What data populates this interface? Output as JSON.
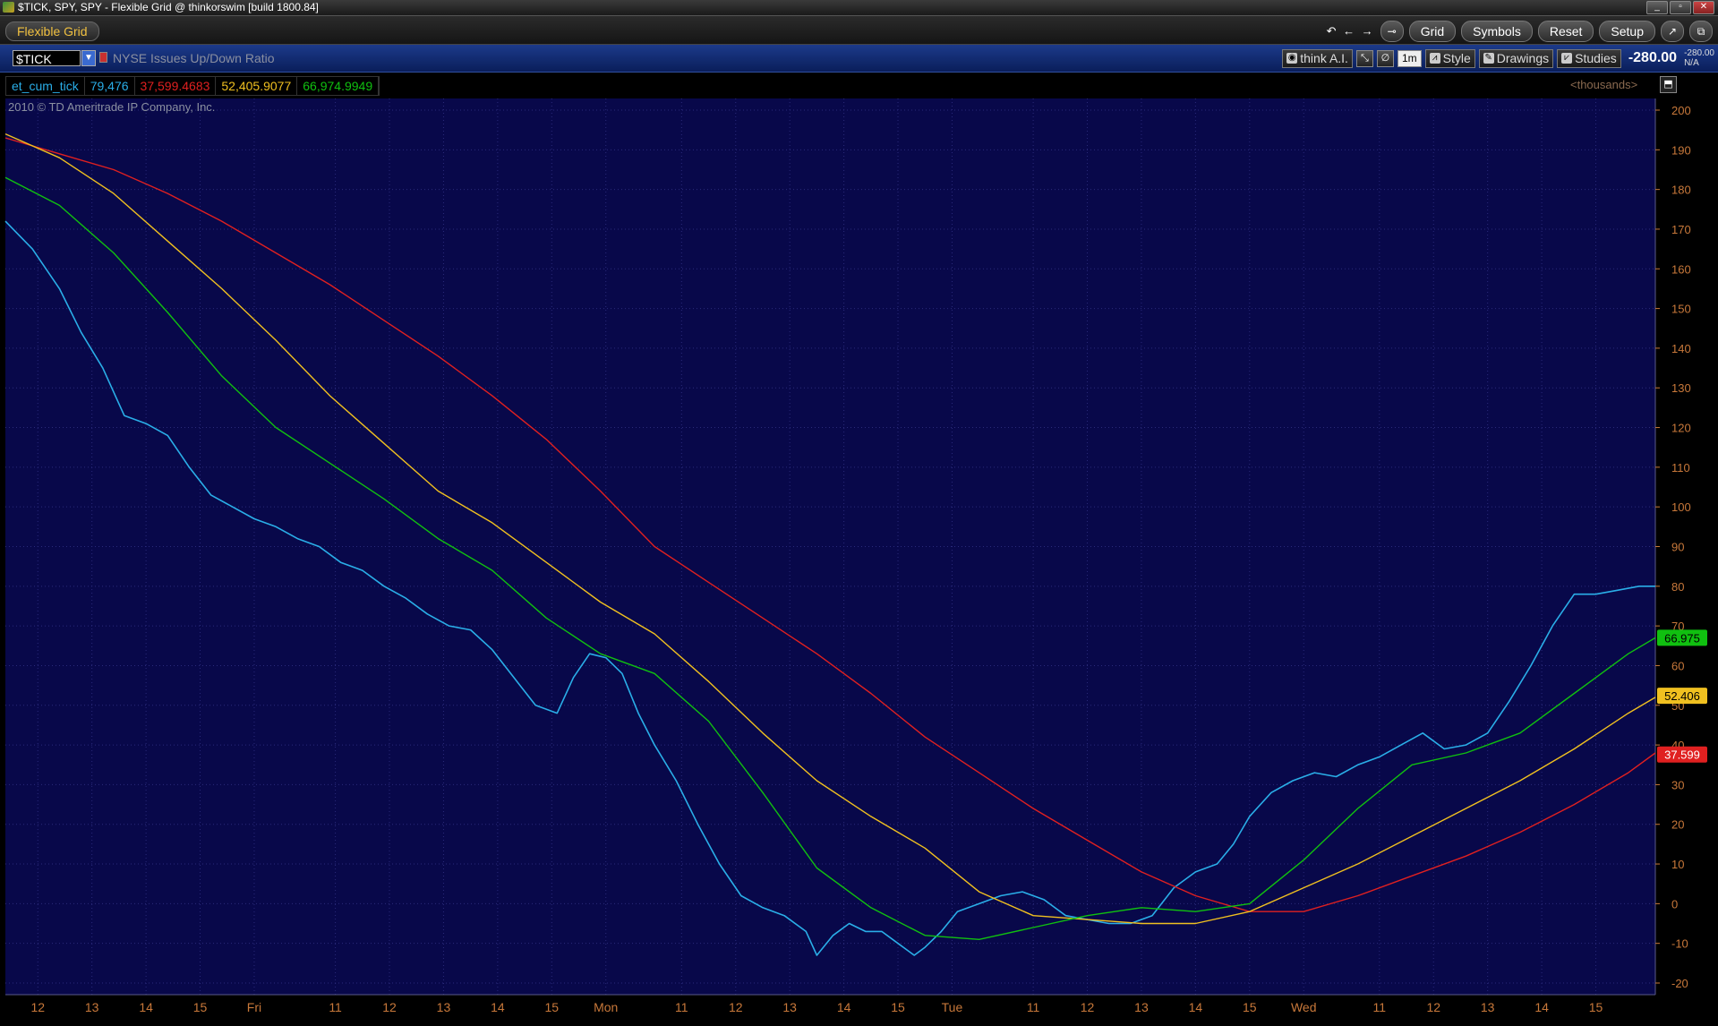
{
  "window": {
    "title": "$TICK, SPY, SPY - Flexible Grid @ thinkorswim [build 1800.84]",
    "controls": [
      "_",
      "▫",
      "✕"
    ]
  },
  "toolbar": {
    "grid_name": "Flexible Grid",
    "nav_arrows": "↶ ← →",
    "buttons": [
      "Grid",
      "Symbols",
      "Reset",
      "Setup"
    ]
  },
  "chart_header": {
    "symbol": "$TICK",
    "description": "NYSE Issues Up/Down Ratio",
    "think_ai": "think A.I.",
    "timeframe": "1m",
    "style": "Style",
    "drawings": "Drawings",
    "studies": "Studies",
    "last_price": "-280.00",
    "price_change": "-280.00",
    "price_pct": "N/A"
  },
  "study_values": {
    "name": "et_cum_tick",
    "v1": "79,476",
    "v2": "37,599.4683",
    "v3": "52,405.9077",
    "v4": "66,974.9949"
  },
  "units_label": "<thousands>",
  "copyright": "2010 © TD Ameritrade IP Company, Inc.",
  "colors": {
    "background": "#08084a",
    "grid": "#2a2a7a",
    "tick_series": "#2aaee8",
    "red_series": "#e02020",
    "yellow_series": "#f0c020",
    "green_series": "#10c010",
    "axis_text": "#c8783a"
  },
  "chart_data": {
    "type": "line",
    "units": "thousands",
    "ylim": [
      -20,
      200
    ],
    "y_ticks": [
      -20,
      -10,
      0,
      10,
      20,
      30,
      40,
      50,
      60,
      70,
      80,
      90,
      100,
      110,
      120,
      130,
      140,
      150,
      160,
      170,
      180,
      190,
      200
    ],
    "x_tick_labels": [
      "12",
      "13",
      "14",
      "15",
      "Fri",
      "11",
      "12",
      "13",
      "14",
      "15",
      "Mon",
      "11",
      "12",
      "13",
      "14",
      "15",
      "Tue",
      "11",
      "12",
      "13",
      "14",
      "15",
      "Wed",
      "11",
      "12",
      "13",
      "14",
      "15"
    ],
    "x_tick_positions": [
      0.6,
      1.6,
      2.6,
      3.6,
      4.6,
      6.1,
      7.1,
      8.1,
      9.1,
      10.1,
      11.1,
      12.5,
      13.5,
      14.5,
      15.5,
      16.5,
      17.5,
      19.0,
      20.0,
      21.0,
      22.0,
      23.0,
      24.0,
      25.4,
      26.4,
      27.4,
      28.4,
      29.4
    ],
    "x_range": [
      0,
      30.5
    ],
    "series": [
      {
        "key": "tick",
        "values": [
          [
            0,
            172
          ],
          [
            0.5,
            165
          ],
          [
            1.0,
            155
          ],
          [
            1.4,
            144
          ],
          [
            1.8,
            135
          ],
          [
            2.2,
            123
          ],
          [
            2.6,
            121
          ],
          [
            3.0,
            118
          ],
          [
            3.4,
            110
          ],
          [
            3.8,
            103
          ],
          [
            4.2,
            100
          ],
          [
            4.6,
            97
          ],
          [
            5.0,
            95
          ],
          [
            5.4,
            92
          ],
          [
            5.8,
            90
          ],
          [
            6.2,
            86
          ],
          [
            6.6,
            84
          ],
          [
            7.0,
            80
          ],
          [
            7.4,
            77
          ],
          [
            7.8,
            73
          ],
          [
            8.2,
            70
          ],
          [
            8.6,
            69
          ],
          [
            9.0,
            64
          ],
          [
            9.4,
            57
          ],
          [
            9.8,
            50
          ],
          [
            10.2,
            48
          ],
          [
            10.5,
            57
          ],
          [
            10.8,
            63
          ],
          [
            11.1,
            62
          ],
          [
            11.4,
            58
          ],
          [
            11.7,
            48
          ],
          [
            12.0,
            40
          ],
          [
            12.4,
            31
          ],
          [
            12.8,
            20
          ],
          [
            13.2,
            10
          ],
          [
            13.6,
            2
          ],
          [
            14.0,
            -1
          ],
          [
            14.4,
            -3
          ],
          [
            14.8,
            -7
          ],
          [
            15.0,
            -13
          ],
          [
            15.3,
            -8
          ],
          [
            15.6,
            -5
          ],
          [
            15.9,
            -7
          ],
          [
            16.2,
            -7
          ],
          [
            16.5,
            -10
          ],
          [
            16.8,
            -13
          ],
          [
            17.0,
            -11
          ],
          [
            17.3,
            -7
          ],
          [
            17.6,
            -2
          ],
          [
            18.0,
            0
          ],
          [
            18.4,
            2
          ],
          [
            18.8,
            3
          ],
          [
            19.2,
            1
          ],
          [
            19.6,
            -3
          ],
          [
            20.0,
            -4
          ],
          [
            20.4,
            -5
          ],
          [
            20.8,
            -5
          ],
          [
            21.2,
            -3
          ],
          [
            21.6,
            4
          ],
          [
            22.0,
            8
          ],
          [
            22.4,
            10
          ],
          [
            22.7,
            15
          ],
          [
            23.0,
            22
          ],
          [
            23.4,
            28
          ],
          [
            23.8,
            31
          ],
          [
            24.2,
            33
          ],
          [
            24.6,
            32
          ],
          [
            25.0,
            35
          ],
          [
            25.4,
            37
          ],
          [
            25.8,
            40
          ],
          [
            26.2,
            43
          ],
          [
            26.6,
            39
          ],
          [
            27.0,
            40
          ],
          [
            27.4,
            43
          ],
          [
            27.8,
            51
          ],
          [
            28.2,
            60
          ],
          [
            28.6,
            70
          ],
          [
            29.0,
            78
          ],
          [
            29.4,
            78
          ],
          [
            29.8,
            79
          ],
          [
            30.2,
            80
          ],
          [
            30.5,
            80
          ]
        ]
      },
      {
        "key": "red",
        "values": [
          [
            0,
            193
          ],
          [
            1,
            189
          ],
          [
            2,
            185
          ],
          [
            3,
            179
          ],
          [
            4,
            172
          ],
          [
            5,
            164
          ],
          [
            6,
            156
          ],
          [
            7,
            147
          ],
          [
            8,
            138
          ],
          [
            9,
            128
          ],
          [
            10,
            117
          ],
          [
            11,
            104
          ],
          [
            12,
            90
          ],
          [
            13,
            81
          ],
          [
            14,
            72
          ],
          [
            15,
            63
          ],
          [
            16,
            53
          ],
          [
            17,
            42
          ],
          [
            18,
            33
          ],
          [
            19,
            24
          ],
          [
            20,
            16
          ],
          [
            21,
            8
          ],
          [
            22,
            2
          ],
          [
            23,
            -2
          ],
          [
            24,
            -2
          ],
          [
            25,
            2
          ],
          [
            26,
            7
          ],
          [
            27,
            12
          ],
          [
            28,
            18
          ],
          [
            29,
            25
          ],
          [
            30,
            33
          ],
          [
            30.5,
            38
          ]
        ]
      },
      {
        "key": "yellow",
        "values": [
          [
            0,
            194
          ],
          [
            1,
            188
          ],
          [
            2,
            179
          ],
          [
            3,
            167
          ],
          [
            4,
            155
          ],
          [
            5,
            142
          ],
          [
            6,
            128
          ],
          [
            7,
            116
          ],
          [
            8,
            104
          ],
          [
            9,
            96
          ],
          [
            10,
            86
          ],
          [
            11,
            76
          ],
          [
            12,
            68
          ],
          [
            13,
            56
          ],
          [
            14,
            43
          ],
          [
            15,
            31
          ],
          [
            16,
            22
          ],
          [
            17,
            14
          ],
          [
            18,
            3
          ],
          [
            19,
            -3
          ],
          [
            20,
            -4
          ],
          [
            21,
            -5
          ],
          [
            22,
            -5
          ],
          [
            23,
            -2
          ],
          [
            24,
            4
          ],
          [
            25,
            10
          ],
          [
            26,
            17
          ],
          [
            27,
            24
          ],
          [
            28,
            31
          ],
          [
            29,
            39
          ],
          [
            30,
            48
          ],
          [
            30.5,
            52
          ]
        ]
      },
      {
        "key": "green",
        "values": [
          [
            0,
            183
          ],
          [
            1,
            176
          ],
          [
            2,
            164
          ],
          [
            3,
            149
          ],
          [
            4,
            133
          ],
          [
            5,
            120
          ],
          [
            6,
            111
          ],
          [
            7,
            102
          ],
          [
            8,
            92
          ],
          [
            9,
            84
          ],
          [
            10,
            72
          ],
          [
            11,
            63
          ],
          [
            12,
            58
          ],
          [
            13,
            46
          ],
          [
            14,
            28
          ],
          [
            15,
            9
          ],
          [
            16,
            -1
          ],
          [
            17,
            -8
          ],
          [
            18,
            -9
          ],
          [
            19,
            -6
          ],
          [
            20,
            -3
          ],
          [
            21,
            -1
          ],
          [
            22,
            -2
          ],
          [
            23,
            0
          ],
          [
            24,
            11
          ],
          [
            25,
            24
          ],
          [
            26,
            35
          ],
          [
            27,
            38
          ],
          [
            28,
            43
          ],
          [
            29,
            53
          ],
          [
            30,
            63
          ],
          [
            30.5,
            67
          ]
        ]
      }
    ],
    "price_labels": [
      {
        "text": "66.975",
        "value": 67,
        "color": "#10c010"
      },
      {
        "text": "52.406",
        "value": 52.4,
        "color": "#f0c020"
      },
      {
        "text": "37.599",
        "value": 37.6,
        "color": "#e02020"
      }
    ]
  }
}
